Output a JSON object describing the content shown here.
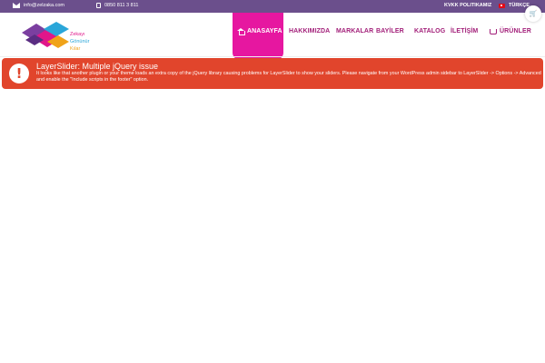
{
  "topbar": {
    "email": "info@zelzaka.com",
    "phone": "0850 811 3 811",
    "kvkk": "KVKK POLITIKAMIZ",
    "language": "TÜRKÇE"
  },
  "logo": {
    "line1": "Zekayı",
    "line2": "Gönünür",
    "line3": "Kılar"
  },
  "nav": {
    "home": "ANASAYFA",
    "about": "HAKKIMIZDA",
    "brands": "MARKALAR",
    "dealers": "BAYİLER",
    "catalog": "KATALOG",
    "contact": "İLETİŞİM",
    "products": "ÜRÜNLER"
  },
  "alert": {
    "icon": "!",
    "title": "LayerSlider: Multiple jQuery issue",
    "text": "It looks like that another plugin or your theme loads an extra copy of the jQuery library causing problems for LayerSlider to show your sliders. Please navigate from your WordPress admin sidebar to LayerSlider -> Options -> Advanced and enable the \"Include scripts in the footer\" option."
  },
  "colors": {
    "topbar": "#6b4f8c",
    "nav_accent": "#e617a0",
    "nav_text": "#a21f79",
    "alert": "#e1452c"
  }
}
